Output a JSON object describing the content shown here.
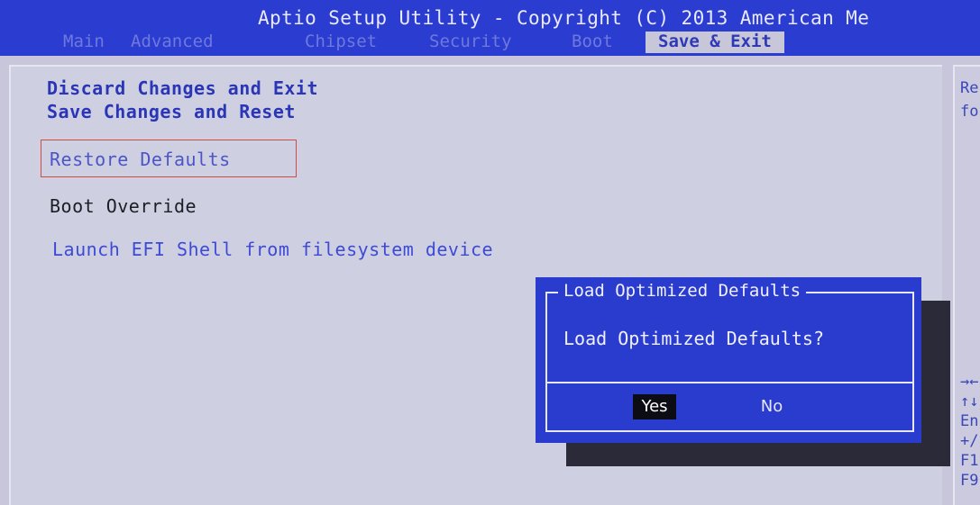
{
  "header": {
    "title": "Aptio Setup Utility - Copyright (C) 2013 American Me",
    "tabs": [
      "Main",
      "Advanced",
      "Chipset",
      "Security",
      "Boot",
      "Save & Exit"
    ]
  },
  "menu": {
    "items": [
      "Discard Changes and Exit",
      "Save Changes and Reset",
      "Restore Defaults",
      "Boot Override",
      "Launch EFI Shell from filesystem device"
    ]
  },
  "dialog": {
    "title": "Load Optimized Defaults",
    "message": "Load Optimized Defaults?",
    "yes_label": "Yes",
    "no_label": "No"
  },
  "help_panel": {
    "lines": [
      "Re",
      "fo",
      "→←",
      "↑↓",
      "En",
      "+/",
      "F1",
      "F9"
    ]
  },
  "colors": {
    "header_bg": "#2b3cd0",
    "dialog_bg": "#2a3ccd",
    "selection_border": "#d14a4a"
  }
}
